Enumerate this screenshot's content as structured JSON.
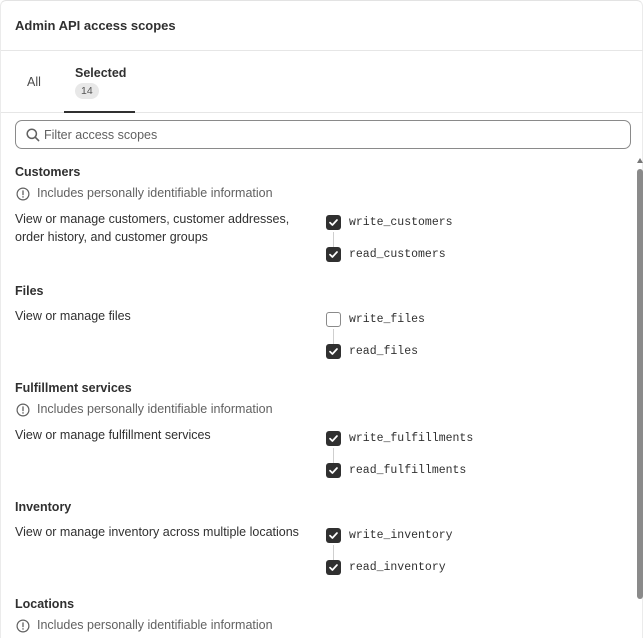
{
  "header": {
    "title": "Admin API access scopes"
  },
  "tabs": {
    "all": {
      "label": "All"
    },
    "selected": {
      "label": "Selected",
      "count": "14"
    }
  },
  "search": {
    "placeholder": "Filter access scopes",
    "value": ""
  },
  "pii_note": "Includes personally identifiable information",
  "sections": [
    {
      "title": "Customers",
      "pii": true,
      "description": "View or manage customers, customer addresses, order history, and customer groups",
      "scopes": [
        {
          "name": "write_customers",
          "checked": true
        },
        {
          "name": "read_customers",
          "checked": true
        }
      ]
    },
    {
      "title": "Files",
      "pii": false,
      "description": "View or manage files",
      "scopes": [
        {
          "name": "write_files",
          "checked": false
        },
        {
          "name": "read_files",
          "checked": true
        }
      ]
    },
    {
      "title": "Fulfillment services",
      "pii": true,
      "description": "View or manage fulfillment services",
      "scopes": [
        {
          "name": "write_fulfillments",
          "checked": true
        },
        {
          "name": "read_fulfillments",
          "checked": true
        }
      ]
    },
    {
      "title": "Inventory",
      "pii": false,
      "description": "View or manage inventory across multiple locations",
      "scopes": [
        {
          "name": "write_inventory",
          "checked": true
        },
        {
          "name": "read_inventory",
          "checked": true
        }
      ]
    },
    {
      "title": "Locations",
      "pii": true
    }
  ],
  "colors": {
    "checked": "#303030",
    "unchecked_border": "#8a8a8a",
    "text": "#303030",
    "muted": "#616161"
  }
}
